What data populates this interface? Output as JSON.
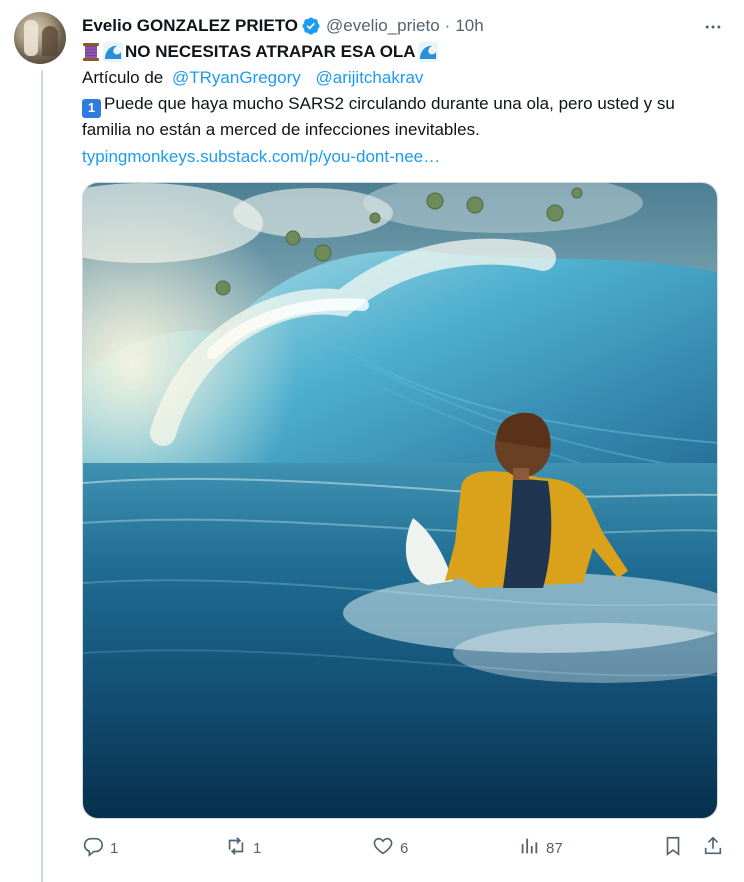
{
  "tweet": {
    "author_name": "Evelio GONZALEZ PRIETO",
    "handle": "@evelio_prieto",
    "separator": "·",
    "time": "10h",
    "title": "NO NECESITAS ATRAPAR ESA OLA",
    "article_prefix": "Artículo de",
    "mentions": [
      "@TRyanGregory",
      "@arijitchakrav"
    ],
    "keycap": "1",
    "body_line1": "Puede que haya mucho SARS2 circulando durante una ola, pero usted y su",
    "body_line2": "familia no están a merced de infecciones inevitables.",
    "link": "typingmonkeys.substack.com/p/you-dont-nee…"
  },
  "actions": {
    "replies": "1",
    "reposts": "1",
    "likes": "6",
    "views": "87"
  },
  "icons": [
    "verified-badge-icon",
    "more-icon",
    "thread-emoji-icon",
    "wave-emoji-icon",
    "reply-icon",
    "repost-icon",
    "like-icon",
    "views-icon",
    "bookmark-icon",
    "share-icon"
  ],
  "colors": {
    "accent": "#1d9bf0",
    "secondary_text": "#536471",
    "text": "#0f1419"
  }
}
